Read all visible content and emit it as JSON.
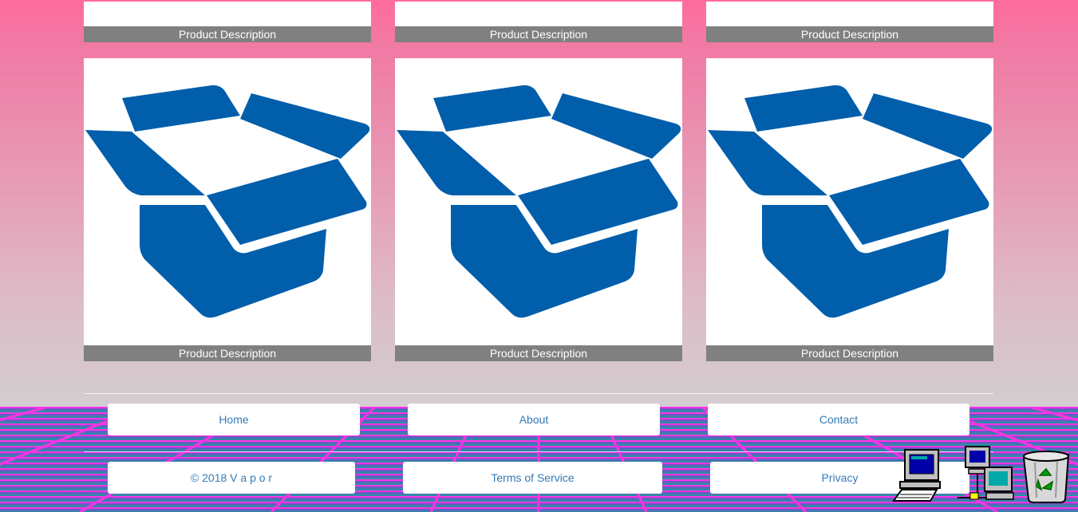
{
  "products": {
    "top_row": [
      {
        "description": "Product Description"
      },
      {
        "description": "Product Description"
      },
      {
        "description": "Product Description"
      }
    ],
    "main_row": [
      {
        "image_icon": "open-box-icon",
        "description": "Product Description"
      },
      {
        "image_icon": "open-box-icon",
        "description": "Product Description"
      },
      {
        "image_icon": "open-box-icon",
        "description": "Product Description"
      }
    ]
  },
  "nav": {
    "home": "Home",
    "about": "About",
    "contact": "Contact"
  },
  "footer": {
    "copyright": "© 2018 V a p o r",
    "terms": "Terms of Service",
    "privacy": "Privacy"
  },
  "desktop_icons": [
    "my-computer-icon",
    "network-neighborhood-icon",
    "recycle-bin-icon"
  ],
  "colors": {
    "box_blue": "#005eab",
    "desc_bar": "#808080",
    "link_blue": "#337ab7",
    "grid_magenta": "#ff33e6",
    "grid_teal": "#1a9c9c"
  }
}
